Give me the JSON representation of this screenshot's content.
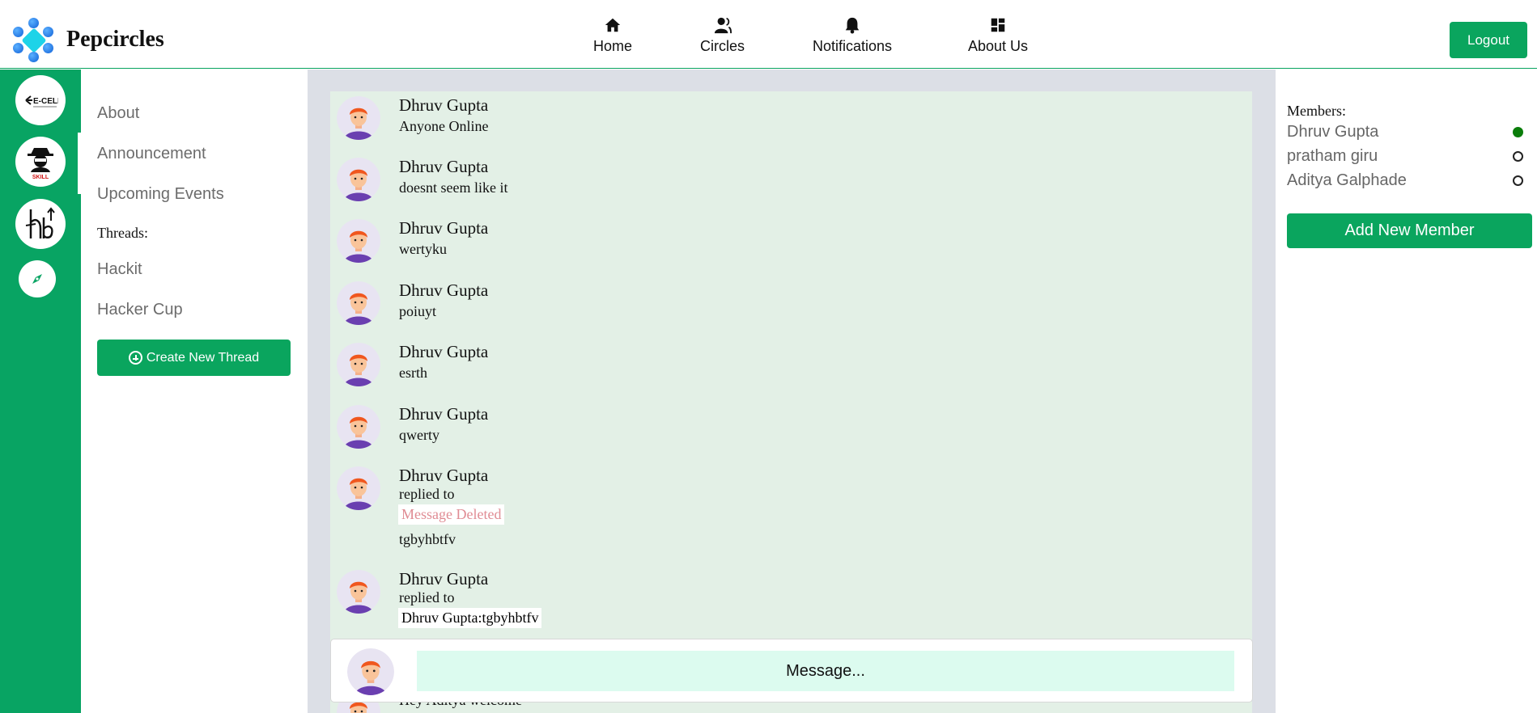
{
  "brand": {
    "name": "Pepcircles"
  },
  "nav": {
    "items": [
      {
        "label": "Home",
        "icon": "home-icon"
      },
      {
        "label": "Circles",
        "icon": "users-icon"
      },
      {
        "label": "Notifications",
        "icon": "bell-icon"
      },
      {
        "label": "About Us",
        "icon": "dashboard-icon"
      }
    ],
    "logout_label": "Logout"
  },
  "rail": {
    "circles": [
      {
        "icon": "ecell-logo-icon",
        "logo_text": "E-CELL"
      },
      {
        "icon": "skill-hacker-logo-icon",
        "logo_text": "SKILL",
        "selected": true
      },
      {
        "icon": "hd-logo-icon"
      },
      {
        "icon": "compass-icon"
      }
    ]
  },
  "circle_nav": {
    "links": [
      "About",
      "Announcement",
      "Upcoming Events"
    ],
    "threads_heading": "Threads:",
    "threads": [
      "Hackit",
      "Hacker Cup"
    ],
    "create_thread_label": "Create New Thread"
  },
  "messages": [
    {
      "author": "Dhruv Gupta",
      "text": "Anyone Online"
    },
    {
      "author": "Dhruv Gupta",
      "text": "doesnt seem like it"
    },
    {
      "author": "Dhruv Gupta",
      "text": "wertyku"
    },
    {
      "author": "Dhruv Gupta",
      "text": "poiuyt"
    },
    {
      "author": "Dhruv Gupta",
      "text": "esrth"
    },
    {
      "author": "Dhruv Gupta",
      "text": "qwerty"
    },
    {
      "author": "Dhruv Gupta",
      "replied_label": "replied to",
      "reply_to": "Message Deleted",
      "text": "tgbyhbtfv"
    },
    {
      "author": "Dhruv Gupta",
      "replied_label": "replied to",
      "reply_to": "Dhruv Gupta:tgbyhbtfv"
    },
    {
      "author": "",
      "text": "Hey Aditya welcome"
    }
  ],
  "composer": {
    "placeholder": "Message..."
  },
  "members": {
    "heading": "Members:",
    "list": [
      {
        "name": "Dhruv Gupta",
        "status": "online"
      },
      {
        "name": "pratham giru",
        "status": "offline"
      },
      {
        "name": "Aditya Galphade",
        "status": "offline"
      }
    ],
    "add_label": "Add New Member"
  },
  "colors": {
    "accent": "#0aa55e",
    "chat_bg": "#e3f0e6",
    "online": "#0a7d0a",
    "deleted_text": "#e08c94",
    "composer_input": "#dcfbef"
  }
}
